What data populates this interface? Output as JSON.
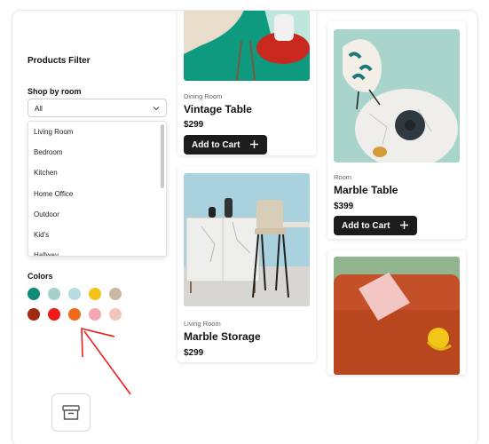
{
  "sidebar": {
    "title": "Products Filter",
    "room_label": "Shop by room",
    "room_select_value": "All",
    "room_options": [
      "Living Room",
      "Bedroom",
      "Kitchen",
      "Home Office",
      "Outdoor",
      "Kid's",
      "Hallway"
    ],
    "colors_label": "Colors",
    "colors": [
      "#0e8a76",
      "#a6cfcb",
      "#b7dbe1",
      "#f2c418",
      "#c9b9a4",
      "#9f2c10",
      "#ee1a1a",
      "#ef6a19",
      "#f3a8b2",
      "#f1c7bd"
    ]
  },
  "products": [
    {
      "category": "Dining Room",
      "name": "Vintage Table",
      "price": "$299",
      "cart_label": "Add to Cart"
    },
    {
      "category": "Living Room",
      "name": "Marble Storage",
      "price": "$299"
    },
    {
      "category": "Room",
      "name": "Marble Table",
      "price": "$399",
      "cart_label": "Add to Cart"
    }
  ],
  "icons": [
    "chevron-down-icon",
    "archive-icon",
    "plus-icon",
    "annotation-arrow"
  ]
}
